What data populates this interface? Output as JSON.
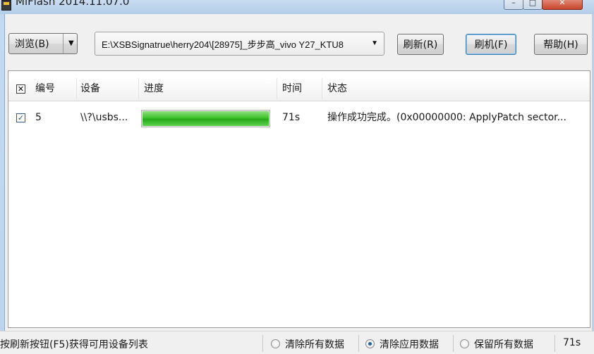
{
  "window": {
    "title": "MiFlash 2014.11.07.0",
    "icon": "miflash-app-icon",
    "controls": {
      "minimize": "–",
      "maximize": "□",
      "close": "✕"
    }
  },
  "toolbar": {
    "browse_label": "浏览(B)",
    "path_value": "E:\\XSBSignatrue\\herry204\\[28975]_步步高_vivo Y27_KTU8",
    "refresh_label": "刷新(R)",
    "flash_label": "刷机(F)",
    "help_label": "帮助(H)"
  },
  "device_list": {
    "columns": [
      "编号",
      "设备",
      "进度",
      "时间",
      "状态"
    ],
    "rows": [
      {
        "checked": true,
        "id": "5",
        "device": "\\\\?\\usbs...",
        "progress": 1.0,
        "time": "71s",
        "status": "操作成功完成。(0x00000000: ApplyPatch sector..."
      }
    ]
  },
  "statusbar": {
    "hint": "按刷新按钮(F5)获得可用设备列表",
    "options": [
      {
        "label": "清除所有数据",
        "selected": false
      },
      {
        "label": "清除应用数据",
        "selected": true
      },
      {
        "label": "保留所有数据",
        "selected": false
      }
    ],
    "elapsed": "71s"
  },
  "colors": {
    "progress_fill": "#3fc32c",
    "title_bar": "#b9d1ea",
    "radio_selected": "#1d5fa9"
  }
}
